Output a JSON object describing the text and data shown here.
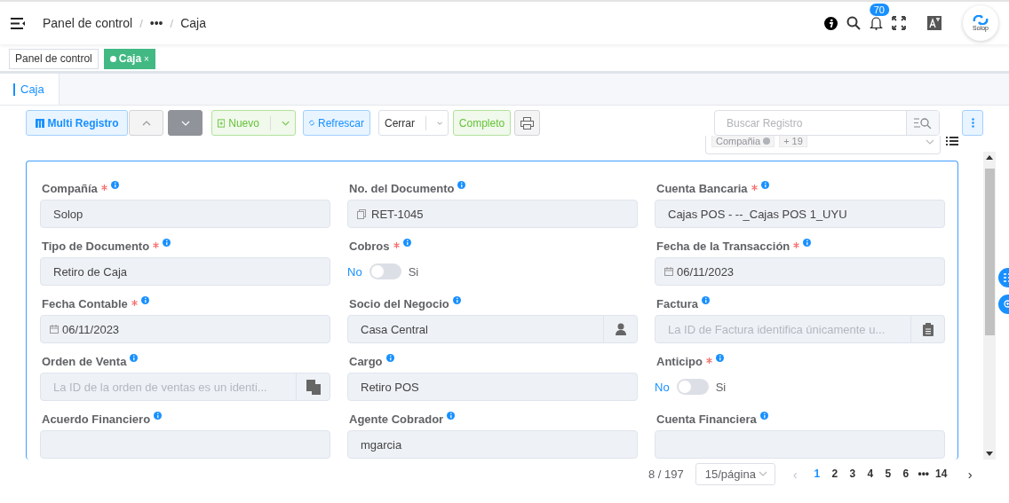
{
  "header": {
    "breadcrumbs": [
      {
        "label": "Panel de control"
      },
      {
        "separator": "/",
        "label": "•••"
      },
      {
        "separator": "/",
        "label": "Caja"
      }
    ],
    "notifications": "70",
    "avatar": "Solop"
  },
  "tags": [
    {
      "label": "Panel de control",
      "selected": false,
      "closable": false
    },
    {
      "label": "Caja",
      "selected": true,
      "closable": true,
      "close": "×"
    }
  ],
  "tabs": [
    {
      "label": "Caja",
      "selected": true
    }
  ],
  "toolbar": {
    "multi": "Multi Registro",
    "new": "Nuevo",
    "refresh": "Refrescar",
    "close": "Cerrar",
    "complete": "Completo",
    "search": {
      "placeholder": "Buscar Registro"
    }
  },
  "filters": [
    {
      "label": "Compañia",
      "removable": true
    },
    {
      "label": "+ 19",
      "removable": false
    }
  ],
  "fields": [
    {
      "label": "Compañía",
      "required": true,
      "kind": "text",
      "value": "Solop"
    },
    {
      "label": "No. del Documento",
      "required": false,
      "kind": "doc",
      "value": "RET-1045"
    },
    {
      "label": "Cuenta Bancaria",
      "required": true,
      "kind": "text",
      "value": "Cajas POS - --_Cajas POS 1_UYU"
    },
    {
      "label": "Tipo de Documento",
      "required": true,
      "kind": "text",
      "value": "Retiro de Caja"
    },
    {
      "label": "Cobros",
      "required": true,
      "kind": "switch",
      "on": false,
      "off_label": "No",
      "on_label": "Si"
    },
    {
      "label": "Fecha de la Transacción",
      "required": true,
      "kind": "date",
      "value": "06/11/2023"
    },
    {
      "label": "Fecha Contable",
      "required": true,
      "kind": "date",
      "value": "06/11/2023"
    },
    {
      "label": "Socio del Negocio",
      "required": false,
      "kind": "person",
      "value": "Casa Central"
    },
    {
      "label": "Factura",
      "required": false,
      "kind": "clipboard",
      "placeholder": "La ID de Factura identifica únicamente u..."
    },
    {
      "label": "Orden de Venta",
      "required": false,
      "kind": "copy",
      "placeholder": "La ID de la orden de ventas es un identi..."
    },
    {
      "label": "Cargo",
      "required": false,
      "kind": "text",
      "value": "Retiro POS"
    },
    {
      "label": "Anticipo",
      "required": true,
      "kind": "switch",
      "on": false,
      "off_label": "No",
      "on_label": "Si"
    },
    {
      "label": "Acuerdo Financiero",
      "required": false,
      "kind": "text"
    },
    {
      "label": "Agente Cobrador",
      "required": false,
      "kind": "text",
      "value": "mgarcia"
    },
    {
      "label": "Cuenta Financiera",
      "required": false,
      "kind": "text"
    }
  ],
  "pagination": {
    "count": "8 / 197",
    "page_size": "15/página",
    "prev": "‹",
    "next": "›",
    "pages": [
      {
        "label": "1",
        "selected": true
      },
      {
        "label": "2",
        "selected": false
      },
      {
        "label": "3",
        "selected": false
      },
      {
        "label": "4",
        "selected": false
      },
      {
        "label": "5",
        "selected": false
      },
      {
        "label": "6",
        "selected": false
      },
      {
        "label": "•••",
        "selected": false
      },
      {
        "label": "14",
        "selected": false
      }
    ]
  }
}
